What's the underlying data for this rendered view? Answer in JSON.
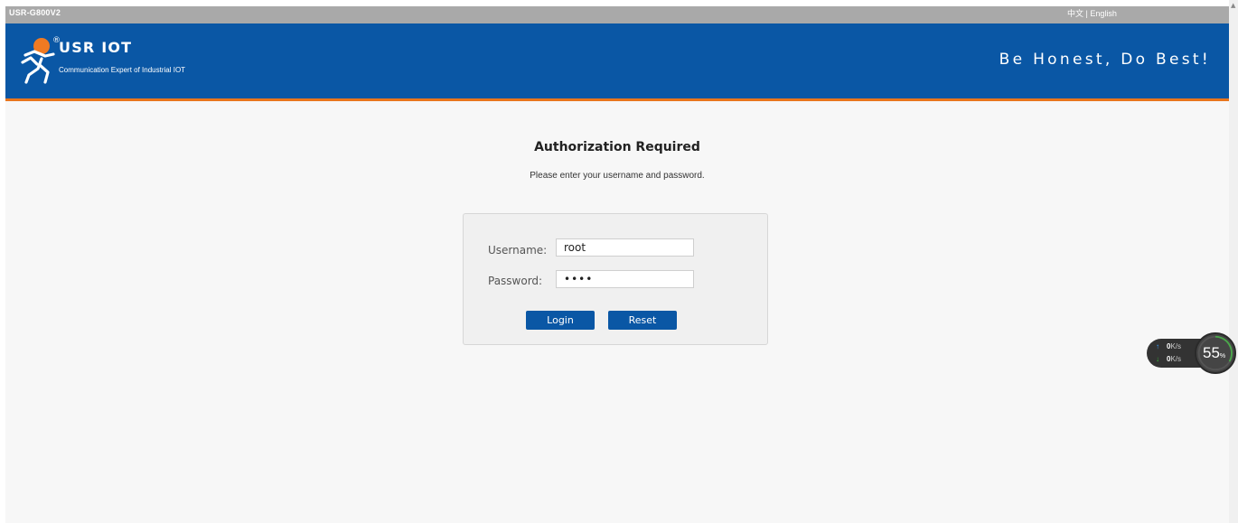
{
  "topbar": {
    "device": "USR-G800V2",
    "lang_zh": "中文",
    "separator": " | ",
    "lang_en": "English"
  },
  "header": {
    "brand": "USR IOT",
    "subtitle": "Communication Expert of Industrial IOT",
    "slogan": "Be Honest, Do Best!",
    "registered_mark": "®"
  },
  "login": {
    "title": "Authorization Required",
    "description": "Please enter your username and password.",
    "username_label": "Username:",
    "username_value": "root",
    "password_label": "Password:",
    "password_value": "••••",
    "login_label": "Login",
    "reset_label": "Reset"
  },
  "net_monitor": {
    "up_arrow": "↑",
    "up_value": "0",
    "up_unit": "K/s",
    "down_arrow": "↓",
    "down_value": "0",
    "down_unit": "K/s",
    "percent_value": "55",
    "percent_unit": "%"
  },
  "colors": {
    "header_blue": "#0a57a5",
    "accent_orange": "#e9751d",
    "button_blue": "#0a57a5"
  },
  "icons": {
    "logo": "usr-iot-logo-icon",
    "upload": "arrow-up-icon",
    "download": "arrow-down-icon"
  }
}
